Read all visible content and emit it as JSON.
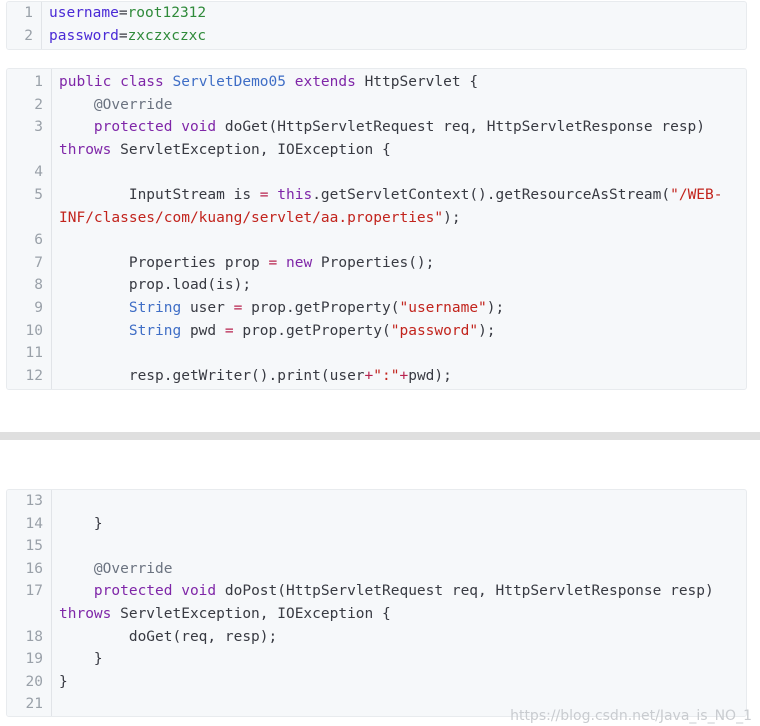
{
  "block1": {
    "lines": [
      {
        "n": "1",
        "parts": [
          {
            "t": "username",
            "c": "key"
          },
          {
            "t": "=",
            "c": ""
          },
          {
            "t": "root12312",
            "c": "val"
          }
        ]
      },
      {
        "n": "2",
        "parts": [
          {
            "t": "password",
            "c": "key"
          },
          {
            "t": "=",
            "c": ""
          },
          {
            "t": "zxczxczxc",
            "c": "val"
          }
        ]
      }
    ]
  },
  "block2": {
    "lines": [
      {
        "n": "1",
        "parts": [
          {
            "t": "public class ",
            "c": "kw"
          },
          {
            "t": "ServletDemo05",
            "c": "cls"
          },
          {
            "t": " extends ",
            "c": "kw"
          },
          {
            "t": "HttpServlet {",
            "c": ""
          }
        ]
      },
      {
        "n": "2",
        "parts": [
          {
            "t": "    @Override",
            "c": "ann"
          }
        ]
      },
      {
        "n": "3",
        "parts": [
          {
            "t": "    protected void ",
            "c": "kw"
          },
          {
            "t": "doGet(HttpServletRequest req, HttpServletResponse resp)",
            "c": ""
          }
        ]
      },
      {
        "n": "",
        "parts": [
          {
            "t": "throws ",
            "c": "kw"
          },
          {
            "t": "ServletException, IOException {",
            "c": ""
          }
        ]
      },
      {
        "n": "4",
        "parts": []
      },
      {
        "n": "5",
        "parts": [
          {
            "t": "        InputStream is ",
            "c": ""
          },
          {
            "t": "=",
            "c": "op"
          },
          {
            "t": " this",
            "c": "kw"
          },
          {
            "t": ".getServletContext().getResourceAsStream(",
            "c": ""
          },
          {
            "t": "\"/WEB-",
            "c": "str"
          }
        ]
      },
      {
        "n": "",
        "parts": [
          {
            "t": "INF/classes/com/kuang/servlet/aa.properties\"",
            "c": "str"
          },
          {
            "t": ");",
            "c": ""
          }
        ]
      },
      {
        "n": "6",
        "parts": []
      },
      {
        "n": "7",
        "parts": [
          {
            "t": "        Properties prop ",
            "c": ""
          },
          {
            "t": "=",
            "c": "op"
          },
          {
            "t": " new",
            "c": "kw"
          },
          {
            "t": " Properties();",
            "c": ""
          }
        ]
      },
      {
        "n": "8",
        "parts": [
          {
            "t": "        prop.load(is);",
            "c": ""
          }
        ]
      },
      {
        "n": "9",
        "parts": [
          {
            "t": "        String",
            "c": "type"
          },
          {
            "t": " user ",
            "c": ""
          },
          {
            "t": "=",
            "c": "op"
          },
          {
            "t": " prop.getProperty(",
            "c": ""
          },
          {
            "t": "\"username\"",
            "c": "str"
          },
          {
            "t": ");",
            "c": ""
          }
        ]
      },
      {
        "n": "10",
        "parts": [
          {
            "t": "        String",
            "c": "type"
          },
          {
            "t": " pwd ",
            "c": ""
          },
          {
            "t": "=",
            "c": "op"
          },
          {
            "t": " prop.getProperty(",
            "c": ""
          },
          {
            "t": "\"password\"",
            "c": "str"
          },
          {
            "t": ");",
            "c": ""
          }
        ]
      },
      {
        "n": "11",
        "parts": []
      },
      {
        "n": "12",
        "parts": [
          {
            "t": "        resp.getWriter().print(user",
            "c": ""
          },
          {
            "t": "+",
            "c": "op"
          },
          {
            "t": "\":\"",
            "c": "str"
          },
          {
            "t": "+",
            "c": "op"
          },
          {
            "t": "pwd);",
            "c": ""
          }
        ]
      }
    ]
  },
  "block3": {
    "lines": [
      {
        "n": "13",
        "parts": []
      },
      {
        "n": "14",
        "parts": [
          {
            "t": "    }",
            "c": ""
          }
        ]
      },
      {
        "n": "15",
        "parts": []
      },
      {
        "n": "16",
        "parts": [
          {
            "t": "    @Override",
            "c": "ann"
          }
        ]
      },
      {
        "n": "17",
        "parts": [
          {
            "t": "    protected void ",
            "c": "kw"
          },
          {
            "t": "doPost(HttpServletRequest req, HttpServletResponse resp)",
            "c": ""
          }
        ]
      },
      {
        "n": "",
        "parts": [
          {
            "t": "throws ",
            "c": "kw"
          },
          {
            "t": "ServletException, IOException {",
            "c": ""
          }
        ]
      },
      {
        "n": "18",
        "parts": [
          {
            "t": "        doGet(req, resp);",
            "c": ""
          }
        ]
      },
      {
        "n": "19",
        "parts": [
          {
            "t": "    }",
            "c": ""
          }
        ]
      },
      {
        "n": "20",
        "parts": [
          {
            "t": "}",
            "c": ""
          }
        ]
      },
      {
        "n": "21",
        "parts": []
      }
    ]
  },
  "watermark": "https://blog.csdn.net/Java_is_NO_1"
}
